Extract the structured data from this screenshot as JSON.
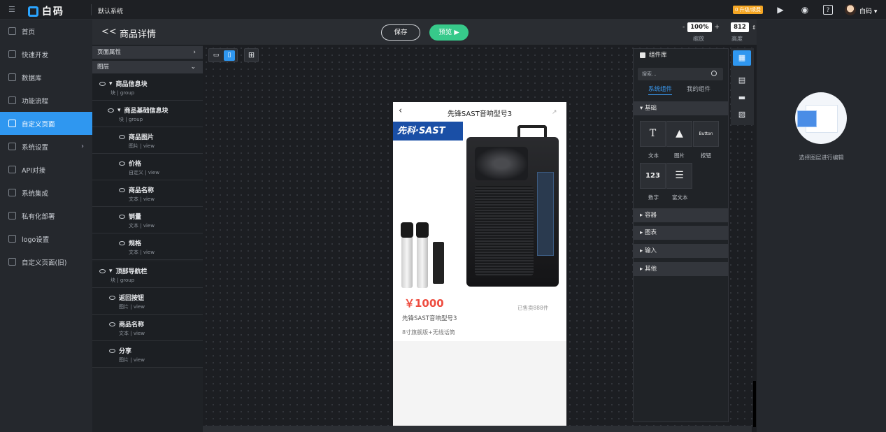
{
  "topbar": {
    "brand": "白码",
    "system_name": "默认系统",
    "upgrade_badge": "0 升级/续费",
    "user_name": "白码 ▾"
  },
  "sidebar": {
    "items": [
      {
        "label": "首页",
        "icon": "home-icon"
      },
      {
        "label": "快速开发",
        "icon": "cube-icon"
      },
      {
        "label": "数据库",
        "icon": "database-icon"
      },
      {
        "label": "功能流程",
        "icon": "flow-icon"
      },
      {
        "label": "自定义页面",
        "icon": "page-icon",
        "active": true
      },
      {
        "label": "系统设置",
        "icon": "settings-icon",
        "has_submenu": true
      },
      {
        "label": "API对接",
        "icon": "api-icon"
      },
      {
        "label": "系统集成",
        "icon": "layers-icon"
      },
      {
        "label": "私有化部署",
        "icon": "server-icon"
      },
      {
        "label": "logo设置",
        "icon": "logo-icon"
      },
      {
        "label": "自定义页面(旧)",
        "icon": "page-old-icon"
      }
    ]
  },
  "header": {
    "back": "<<",
    "title": "商品详情",
    "save": "保存",
    "preview": "预览 ▶",
    "zoom_value": "100%",
    "zoom_label": "缩放",
    "height_value": "812",
    "height_label": "高度"
  },
  "layers": {
    "page_props": "页面属性",
    "layers_title": "图层",
    "nodes": [
      {
        "name": "商品信息块",
        "type": "块",
        "sub": "group"
      },
      {
        "name": "商品基础信息块",
        "type": "块",
        "sub": "group"
      },
      {
        "name": "商品图片",
        "type": "图片",
        "sub": "view"
      },
      {
        "name": "价格",
        "type": "自定义",
        "sub": "view"
      },
      {
        "name": "商品名称",
        "type": "文本",
        "sub": "view"
      },
      {
        "name": "销量",
        "type": "文本",
        "sub": "view"
      },
      {
        "name": "规格",
        "type": "文本",
        "sub": "view"
      },
      {
        "name": "顶部导航栏",
        "type": "块",
        "sub": "group"
      },
      {
        "name": "返回按钮",
        "type": "图片",
        "sub": "view"
      },
      {
        "name": "商品名称",
        "type": "文本",
        "sub": "view"
      },
      {
        "name": "分享",
        "type": "图片",
        "sub": "view"
      }
    ]
  },
  "phone": {
    "title": "先锋SAST音响型号3",
    "brand_text": "先科·SAST",
    "price": "￥1000",
    "sold": "已售卖888件",
    "product_name": "先锋SAST音响型号3",
    "spec": "8寸旗舰版+无线话筒"
  },
  "component_library": {
    "title": "组件库",
    "search_placeholder": "搜索...",
    "tabs": [
      "系统组件",
      "我的组件"
    ],
    "sections": [
      "基础",
      "容器",
      "图表",
      "输入",
      "其他"
    ],
    "basic_tiles": [
      {
        "glyph": "T",
        "label": "文本"
      },
      {
        "glyph": "▲",
        "label": "图片"
      },
      {
        "glyph": "Button",
        "label": "按钮"
      },
      {
        "glyph": "123",
        "label": "数字"
      },
      {
        "glyph": "☰",
        "label": "富文本"
      }
    ]
  },
  "right_panel": {
    "empty_text": "选择图层进行编辑"
  }
}
